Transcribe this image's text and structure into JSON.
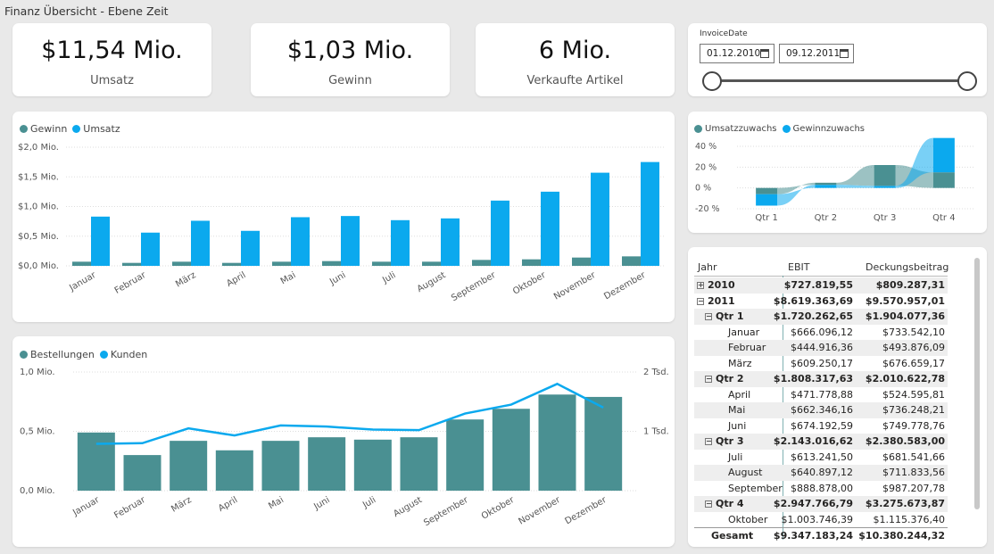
{
  "page_title": "Finanz Übersicht - Ebene Zeit",
  "kpis": [
    {
      "value": "$11,54 Mio.",
      "label": "Umsatz"
    },
    {
      "value": "$1,03 Mio.",
      "label": "Gewinn"
    },
    {
      "value": "6 Mio.",
      "label": "Verkaufte Artikel"
    }
  ],
  "slicer": {
    "title": "InvoiceDate",
    "start_date": "01.12.2010",
    "end_date": "09.12.2011"
  },
  "colors": {
    "teal": "#4a9092",
    "blue": "#0ba9ee"
  },
  "chart_data": [
    {
      "type": "bar",
      "legend": [
        "Gewinn",
        "Umsatz"
      ],
      "legend_position": "top-left",
      "categories": [
        "Januar",
        "Februar",
        "März",
        "April",
        "Mai",
        "Juni",
        "Juli",
        "August",
        "September",
        "Oktober",
        "November",
        "Dezember"
      ],
      "series": [
        {
          "name": "Gewinn",
          "values": [
            0.07,
            0.05,
            0.07,
            0.05,
            0.07,
            0.08,
            0.07,
            0.07,
            0.1,
            0.11,
            0.14,
            0.16
          ]
        },
        {
          "name": "Umsatz",
          "values": [
            0.83,
            0.56,
            0.76,
            0.59,
            0.82,
            0.84,
            0.77,
            0.8,
            1.1,
            1.25,
            1.57,
            1.75
          ]
        }
      ],
      "y_ticks": [
        "$0,0 Mio.",
        "$0,5 Mio.",
        "$1,0 Mio.",
        "$1,5 Mio.",
        "$2,0 Mio."
      ],
      "ylim": [
        0,
        2.0
      ],
      "grid": true
    },
    {
      "type": "bar",
      "legend": [
        "Bestellungen",
        "Kunden"
      ],
      "legend_position": "top-left",
      "categories": [
        "Januar",
        "Februar",
        "März",
        "April",
        "Mai",
        "Juni",
        "Juli",
        "August",
        "September",
        "Oktober",
        "November",
        "Dezember"
      ],
      "series": [
        {
          "name": "Bestellungen",
          "type": "bar",
          "axis": "left",
          "values": [
            0.49,
            0.3,
            0.42,
            0.34,
            0.42,
            0.45,
            0.43,
            0.45,
            0.6,
            0.69,
            0.81,
            0.79
          ]
        },
        {
          "name": "Kunden",
          "type": "line",
          "axis": "right",
          "values": [
            0.79,
            0.8,
            1.05,
            0.93,
            1.1,
            1.08,
            1.03,
            1.02,
            1.3,
            1.45,
            1.8,
            1.4
          ]
        }
      ],
      "y_ticks_left": [
        "0,0 Mio.",
        "0,5 Mio.",
        "1,0 Mio."
      ],
      "y_ticks_right": [
        "1 Tsd.",
        "2 Tsd."
      ],
      "ylim_left": [
        0,
        1.0
      ],
      "ylim_right": [
        0,
        2.0
      ],
      "grid": true
    },
    {
      "type": "area",
      "subtype": "ribbon",
      "legend": [
        "Umsatzzuwachs",
        "Gewinnzuwachs"
      ],
      "legend_position": "top-left",
      "categories": [
        "Qtr 1",
        "Qtr 2",
        "Qtr 3",
        "Qtr 4"
      ],
      "y_ticks": [
        "40 %",
        "20 %",
        "0 %",
        "-20 %"
      ],
      "ylim": [
        -0.2,
        0.4
      ],
      "series": [
        {
          "name": "Umsatzzuwachs",
          "values": [
            -0.06,
            0.02,
            0.2,
            0.15
          ]
        },
        {
          "name": "Gewinnzuwachs",
          "values": [
            -0.11,
            -0.03,
            0.02,
            0.33
          ]
        }
      ]
    }
  ],
  "matrix": {
    "headers": [
      "Jahr",
      "EBIT",
      "Deckungsbeitrag"
    ],
    "rows": [
      {
        "label": "2010",
        "ebit": "$727.819,55",
        "db": "$809.287,31",
        "bold": true,
        "level": 0,
        "expander": "⊞"
      },
      {
        "label": "2011",
        "ebit": "$8.619.363,69",
        "db": "$9.570.957,01",
        "bold": true,
        "level": 0,
        "expander": "⊟"
      },
      {
        "label": "Qtr 1",
        "ebit": "$1.720.262,65",
        "db": "$1.904.077,36",
        "bold": true,
        "level": 1,
        "expander": "⊟"
      },
      {
        "label": "Januar",
        "ebit": "$666.096,12",
        "db": "$733.542,10",
        "bold": false,
        "level": 2
      },
      {
        "label": "Februar",
        "ebit": "$444.916,36",
        "db": "$493.876,09",
        "bold": false,
        "level": 2
      },
      {
        "label": "März",
        "ebit": "$609.250,17",
        "db": "$676.659,17",
        "bold": false,
        "level": 2
      },
      {
        "label": "Qtr 2",
        "ebit": "$1.808.317,63",
        "db": "$2.010.622,78",
        "bold": true,
        "level": 1,
        "expander": "⊟"
      },
      {
        "label": "April",
        "ebit": "$471.778,88",
        "db": "$524.595,81",
        "bold": false,
        "level": 2
      },
      {
        "label": "Mai",
        "ebit": "$662.346,16",
        "db": "$736.248,21",
        "bold": false,
        "level": 2
      },
      {
        "label": "Juni",
        "ebit": "$674.192,59",
        "db": "$749.778,76",
        "bold": false,
        "level": 2
      },
      {
        "label": "Qtr 3",
        "ebit": "$2.143.016,62",
        "db": "$2.380.583,00",
        "bold": true,
        "level": 1,
        "expander": "⊟"
      },
      {
        "label": "Juli",
        "ebit": "$613.241,50",
        "db": "$681.541,66",
        "bold": false,
        "level": 2
      },
      {
        "label": "August",
        "ebit": "$640.897,12",
        "db": "$711.833,56",
        "bold": false,
        "level": 2
      },
      {
        "label": "September",
        "ebit": "$888.878,00",
        "db": "$987.207,78",
        "bold": false,
        "level": 2
      },
      {
        "label": "Qtr 4",
        "ebit": "$2.947.766,79",
        "db": "$3.275.673,87",
        "bold": true,
        "level": 1,
        "expander": "⊟"
      },
      {
        "label": "Oktober",
        "ebit": "$1.003.746,39",
        "db": "$1.115.376,40",
        "bold": false,
        "level": 2
      },
      {
        "label": "Gesamt",
        "ebit": "$9.347.183,24",
        "db": "$10.380.244,32",
        "bold": true,
        "level": 0
      }
    ]
  }
}
